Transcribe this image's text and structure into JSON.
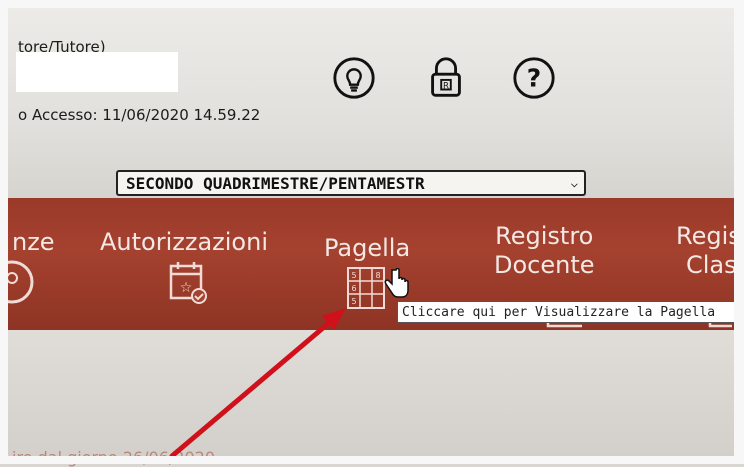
{
  "header": {
    "role_label": "tore/Tutore)",
    "last_access": "o Accesso: 11/06/2020 14.59.22"
  },
  "toolbar": {
    "icons": [
      "lightbulb-icon",
      "lock-icon",
      "help-icon"
    ]
  },
  "period_select": {
    "selected": "SECONDO QUADRIMESTRE/PENTAMESTR"
  },
  "menu": {
    "items": [
      {
        "label": "nze"
      },
      {
        "label": "Autorizzazioni"
      },
      {
        "label": "Pagella"
      },
      {
        "label_line1": "Registro",
        "label_line2": "Docente"
      },
      {
        "label_line1": "Regis",
        "label_line2": "Class"
      }
    ]
  },
  "tooltip": {
    "text": "Cliccare qui per Visualizzare la Pagella"
  },
  "content": {
    "date_text": "ire dal giorno 26/06/2020"
  },
  "colors": {
    "menu_bar": "#a5412f",
    "annotation_arrow": "#d0101a"
  }
}
